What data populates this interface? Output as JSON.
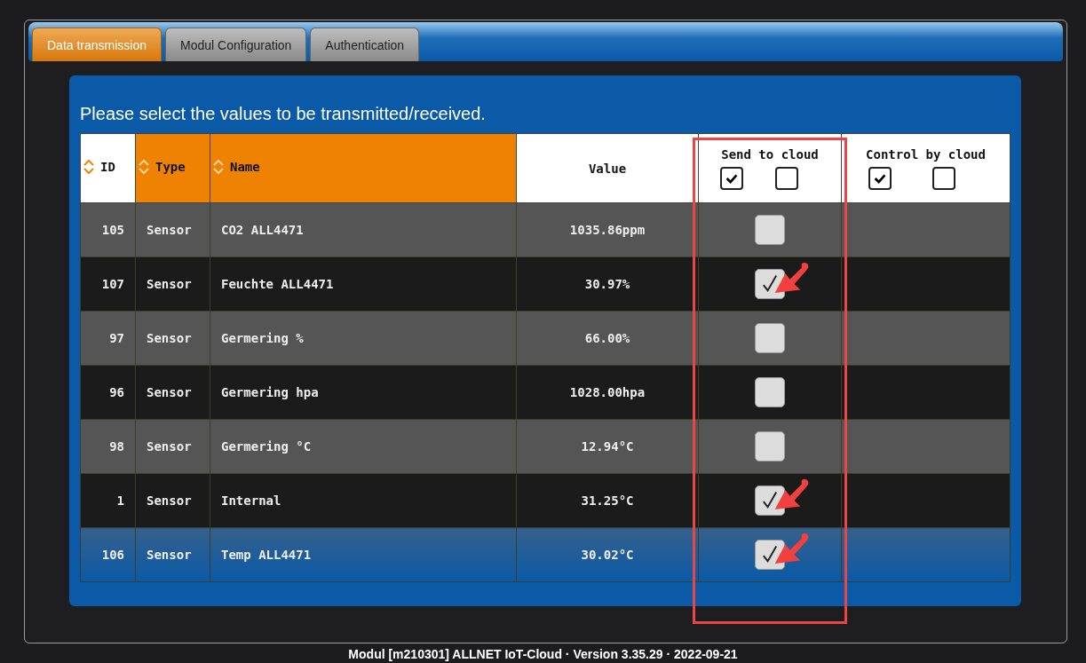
{
  "tabs": [
    {
      "label": "Data transmission",
      "selected": true
    },
    {
      "label": "Modul Configuration",
      "selected": false
    },
    {
      "label": "Authentication",
      "selected": false
    }
  ],
  "instruction": "Please select the values to be transmitted/received.",
  "table": {
    "columns": [
      {
        "label": "ID",
        "kind": "sort",
        "highlighted": false,
        "sort_active": true
      },
      {
        "label": "Type",
        "kind": "sort",
        "highlighted": true,
        "sort_active": false
      },
      {
        "label": "Name",
        "kind": "sort",
        "highlighted": true,
        "sort_active": false
      },
      {
        "label": "Value",
        "kind": "plain",
        "highlighted": false
      },
      {
        "label": "Send to cloud",
        "kind": "toggle",
        "highlighted": false,
        "toggles": [
          {
            "checked": true
          },
          {
            "checked": false
          }
        ]
      },
      {
        "label": "Control by cloud",
        "kind": "toggle",
        "highlighted": false,
        "toggles": [
          {
            "checked": true
          },
          {
            "checked": false
          }
        ]
      }
    ],
    "rows": [
      {
        "id": "105",
        "type": "Sensor",
        "name": "CO2 ALL4471",
        "value": "1035.86ppm",
        "send": false,
        "arrow": false,
        "selected": false
      },
      {
        "id": "107",
        "type": "Sensor",
        "name": "Feuchte ALL4471",
        "value": "30.97%",
        "send": true,
        "arrow": true,
        "selected": false
      },
      {
        "id": "97",
        "type": "Sensor",
        "name": "Germering %",
        "value": "66.00%",
        "send": false,
        "arrow": false,
        "selected": false
      },
      {
        "id": "96",
        "type": "Sensor",
        "name": "Germering hpa",
        "value": "1028.00hpa",
        "send": false,
        "arrow": false,
        "selected": false
      },
      {
        "id": "98",
        "type": "Sensor",
        "name": "Germering °C",
        "value": "12.94°C",
        "send": false,
        "arrow": false,
        "selected": false
      },
      {
        "id": "1",
        "type": "Sensor",
        "name": "Internal",
        "value": "31.25°C",
        "send": true,
        "arrow": true,
        "selected": false
      },
      {
        "id": "106",
        "type": "Sensor",
        "name": "Temp ALL4471",
        "value": "30.02°C",
        "send": true,
        "arrow": true,
        "selected": true
      }
    ]
  },
  "footer": "Modul [m210301] ALLNET IoT-Cloud · Version 3.35.29 · 2022-09-21"
}
